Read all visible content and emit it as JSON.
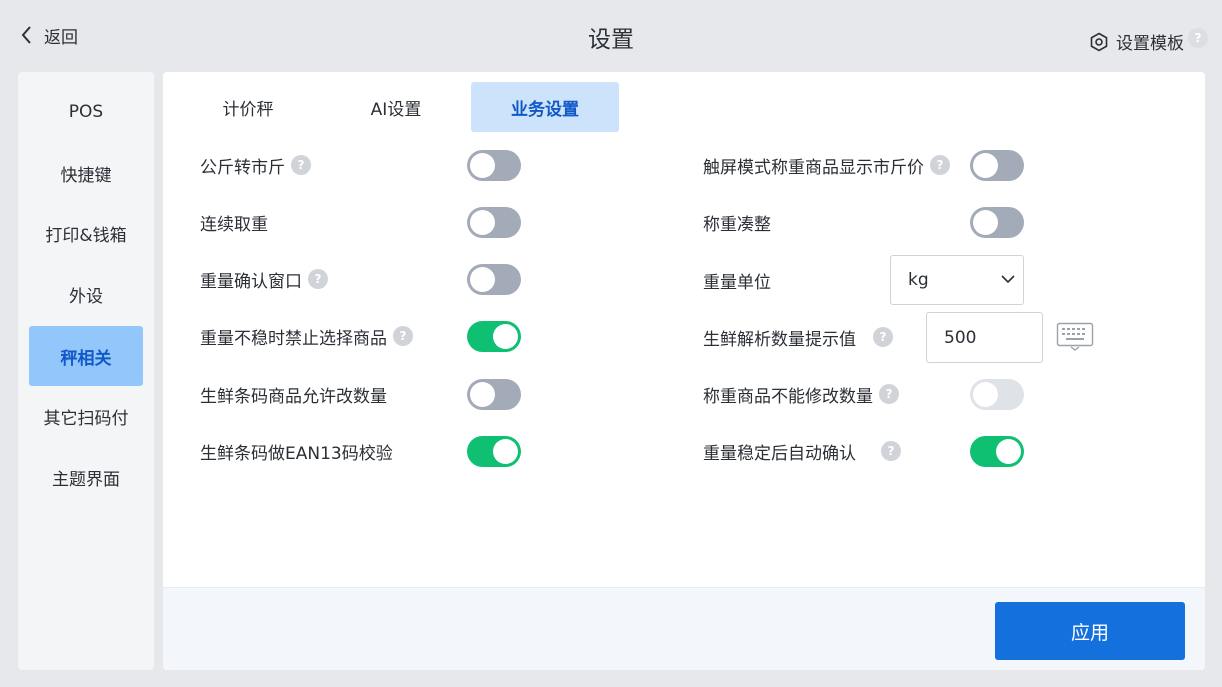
{
  "header": {
    "back_label": "返回",
    "title": "设置",
    "template_label": "设置模板",
    "help_glyph": "?"
  },
  "sidebar": {
    "items": [
      {
        "label": "POS",
        "active": false
      },
      {
        "label": "快捷键",
        "active": false
      },
      {
        "label": "打印&钱箱",
        "active": false
      },
      {
        "label": "外设",
        "active": false
      },
      {
        "label": "秤相关",
        "active": true
      },
      {
        "label": "其它扫码付",
        "active": false
      },
      {
        "label": "主题界面",
        "active": false
      }
    ]
  },
  "tabs": [
    {
      "label": "计价秤",
      "active": false
    },
    {
      "label": "AI设置",
      "active": false
    },
    {
      "label": "业务设置",
      "active": true
    }
  ],
  "settings_left": [
    {
      "label": "公斤转市斤",
      "has_help": true,
      "value": "off"
    },
    {
      "label": "连续取重",
      "has_help": false,
      "value": "off"
    },
    {
      "label": "重量确认窗口",
      "has_help": true,
      "value": "off"
    },
    {
      "label": "重量不稳时禁止选择商品",
      "has_help": true,
      "value": "on"
    },
    {
      "label": "生鲜条码商品允许改数量",
      "has_help": false,
      "value": "off"
    },
    {
      "label": "生鲜条码做EAN13码校验",
      "has_help": false,
      "value": "on"
    }
  ],
  "settings_right": [
    {
      "label": "触屏模式称重商品显示市斤价",
      "has_help": true,
      "value": "off"
    },
    {
      "label": "称重凑整",
      "has_help": false,
      "value": "off"
    },
    {
      "label": "重量单位",
      "has_help": false,
      "select_value": "kg"
    },
    {
      "label": "生鲜解析数量提示值",
      "has_help": true,
      "input_value": "500"
    },
    {
      "label": "称重商品不能修改数量",
      "has_help": true,
      "value": "disabled-off"
    },
    {
      "label": "重量稳定后自动确认",
      "has_help": true,
      "value": "on"
    }
  ],
  "footer": {
    "apply_label": "应用"
  },
  "colors": {
    "accent": "#1470dc",
    "toggle_on": "#0fbf72",
    "toggle_off": "#a3aab8",
    "active_side": "#93c7fb",
    "active_tab": "#cde3fb"
  }
}
